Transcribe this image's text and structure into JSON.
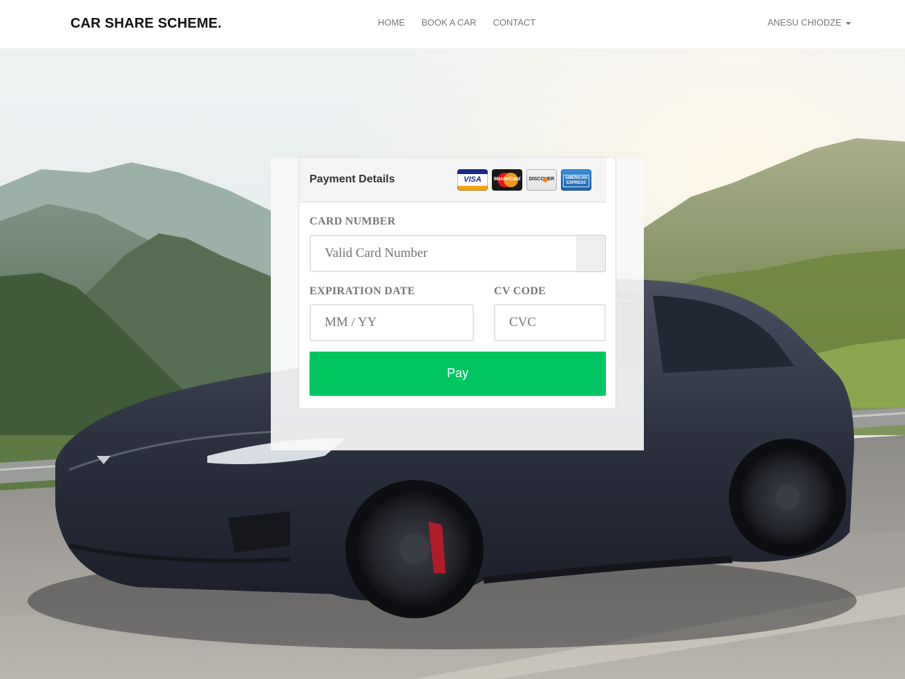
{
  "navbar": {
    "brand": "CAR SHARE SCHEME.",
    "links": [
      "HOME",
      "BOOK A CAR",
      "CONTACT"
    ],
    "user": "ANESU CHIODZE"
  },
  "payment": {
    "title": "Payment Details",
    "card_icons": [
      {
        "name": "visa-icon",
        "text": "VISA"
      },
      {
        "name": "mastercard-icon",
        "text": "MasterCard"
      },
      {
        "name": "discover-icon",
        "text": "DISCOVER"
      },
      {
        "name": "amex-icon",
        "text": "AMERICAN EXPRESS"
      }
    ],
    "card_number": {
      "label": "CARD NUMBER",
      "placeholder": "Valid Card Number",
      "value": ""
    },
    "expiration": {
      "label": "EXPIRATION DATE",
      "placeholder": "MM / YY",
      "value": ""
    },
    "cvc": {
      "label": "CV CODE",
      "placeholder": "CVC",
      "value": ""
    },
    "pay_label": "Pay"
  },
  "colors": {
    "pay_button": "#00c662",
    "nav_text": "#777777",
    "brand_text": "#111111",
    "car_body": "#2c3140"
  }
}
